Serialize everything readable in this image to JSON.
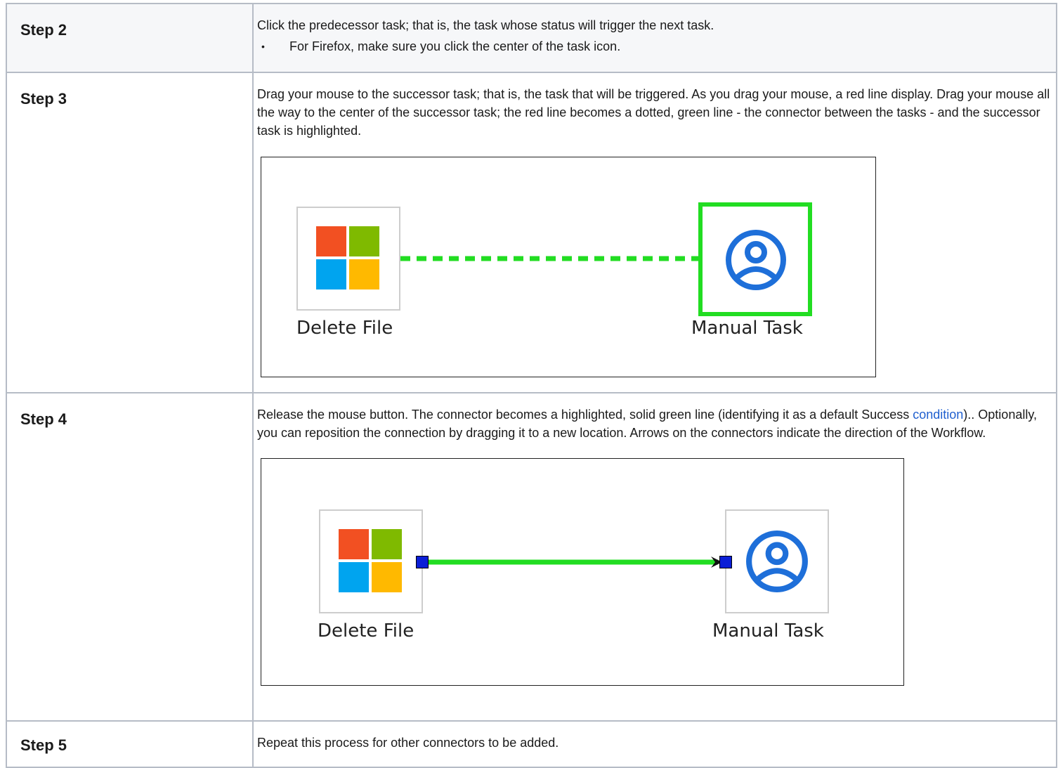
{
  "rows": [
    {
      "step": "Step 2",
      "description": "Click the predecessor task; that is, the task whose status will trigger the next task.",
      "bullets": [
        "For Firefox, make sure you click the center of the task icon."
      ]
    },
    {
      "step": "Step 3",
      "description": "Drag your mouse to the successor task; that is, the task that will be triggered. As you drag your mouse, a red line display. Drag your mouse all the way to the center of the successor task; the red line becomes a dotted, green line - the connector between the tasks - and the successor task is highlighted.",
      "diagram": {
        "source_label": "Delete File",
        "target_label": "Manual Task",
        "connector": "dotted green",
        "connector_color": "#22dd22"
      }
    },
    {
      "step": "Step 4",
      "description_before_link": "Release the mouse button. The connector becomes a highlighted, solid green line (identifying it as a default Success ",
      "link_text": "condition",
      "description_after_link": ").. Optionally, you can reposition the connection by dragging it to a new location. Arrows on the connectors indicate the direction of the Workflow.",
      "diagram": {
        "source_label": "Delete File",
        "target_label": "Manual Task",
        "connector": "solid green with arrow",
        "connector_color": "#22dd22",
        "handle_color": "#0b1fd6"
      }
    },
    {
      "step": "Step 5",
      "description": "Repeat this process for other connectors to be added."
    }
  ],
  "icons": {
    "source_icon": "windows-logo-icon",
    "target_icon": "user-circle-icon",
    "user_icon_color": "#1e6fd9"
  },
  "colors": {
    "border": "#b6bcc6",
    "link": "#1f5fcf"
  }
}
